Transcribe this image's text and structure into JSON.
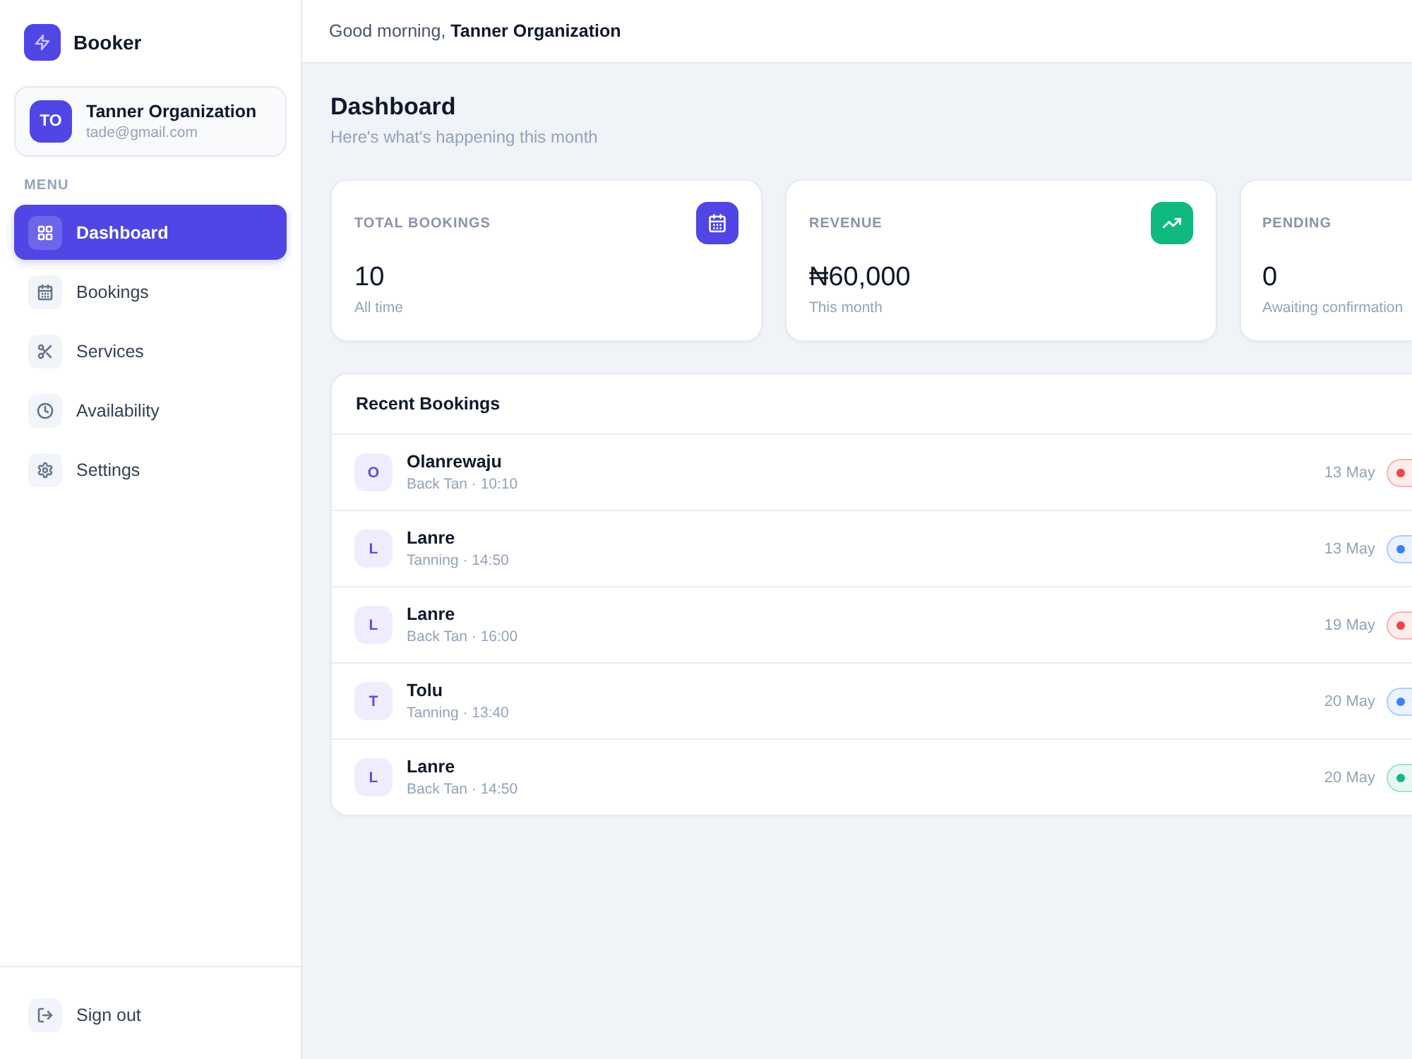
{
  "brand": {
    "name": "Booker"
  },
  "account": {
    "initials": "TO",
    "name": "Tanner Organization",
    "email": "tade@gmail.com"
  },
  "menu": {
    "heading": "MENU",
    "items": [
      {
        "label": "Dashboard",
        "selected": true
      },
      {
        "label": "Bookings",
        "selected": false
      },
      {
        "label": "Services",
        "selected": false
      },
      {
        "label": "Availability",
        "selected": false
      },
      {
        "label": "Settings",
        "selected": false
      }
    ]
  },
  "sign_out": {
    "label": "Sign out"
  },
  "header": {
    "greeting": "Good morning, **Tanner Organization**"
  },
  "page": {
    "title": "Dashboard",
    "subtitle": "Here's what's happening this month"
  },
  "stats": [
    {
      "label": "TOTAL BOOKINGS",
      "value": "10",
      "note": "All time",
      "color": "#4f46e5"
    },
    {
      "label": "REVENUE",
      "value": "₦60,000",
      "note": "This month",
      "color": "#10b981"
    },
    {
      "label": "PENDING",
      "value": "0",
      "note": "Awaiting confirmation"
    }
  ],
  "recent_bookings": {
    "title": "Recent Bookings",
    "items": [
      {
        "initial": "O",
        "name": "Olanrewaju",
        "detail": "Back Tan · 10:10",
        "date": "13 May",
        "color": "#ef4444"
      },
      {
        "initial": "L",
        "name": "Lanre",
        "detail": "Tanning · 14:50",
        "date": "13 May",
        "color": "#3b82f6"
      },
      {
        "initial": "L",
        "name": "Lanre",
        "detail": "Back Tan · 16:00",
        "date": "19 May",
        "color": "#ef4444"
      },
      {
        "initial": "T",
        "name": "Tolu",
        "detail": "Tanning · 13:40",
        "date": "20 May",
        "color": "#3b82f6"
      },
      {
        "initial": "L",
        "name": "Lanre",
        "detail": "Back Tan · 14:50",
        "date": "20 May",
        "color": "#10b981"
      }
    ]
  }
}
